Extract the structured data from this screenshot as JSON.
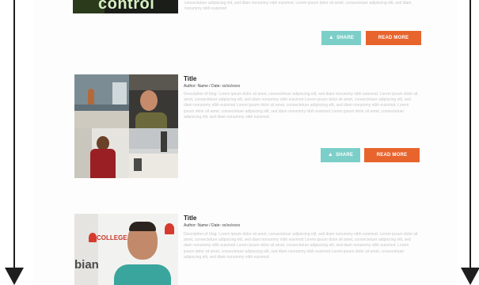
{
  "colors": {
    "share": "#7ccfc8",
    "read_more": "#e8642d",
    "arrow": "#1e1e1e"
  },
  "posts": [
    {
      "thumbnail_text": "control",
      "title": "",
      "meta": "",
      "description": "consectetuer adipiscing elit, sed diam nonummy nibh euismod. Lorem ipsum dolor sit amet, consectetuer adipiscing elit, sed diam nonummy nibh euismod",
      "share_label": "SHARE",
      "read_more_label": "READ MORE"
    },
    {
      "title": "Title",
      "meta": "Author: Name / Date: xx/xx/xxxx",
      "description": "Description of blog: Lorem ipsum dolor sit amet, consectetuer adipiscing elit, sed diam nonummy nibh euismod. Lorem ipsum dolor sit amet, consectetuer adipiscing elit, sed diam nonummy nibh euismod Lorem ipsum dolor sit amet, consectetuer adipiscing elit, sed diam nonummy nibh euismod Lorem ipsum dolor sit amet, consectetuer adipiscing elit, sed diam nonummy nibh euismod. Lorem ipsum dolor sit amet, consectetuer adipiscing elit, sed diam nonummy nibh euismod Lorem ipsum dolor sit amet, consectetuer adipiscing elit, sed diam nonummy nibh euismod.",
      "share_label": "SHARE",
      "read_more_label": "READ MORE"
    },
    {
      "thumbnail_text": "COLLEGE TO",
      "thumbnail_text_2": "bian",
      "title": "Title",
      "meta": "Author: Name / Date: xx/xx/xxxx",
      "description": "Description of blog: Lorem ipsum dolor sit amet, consectetuer adipiscing elit, sed diam nonummy nibh euismod. Lorem ipsum dolor sit amet, consectetuer adipiscing elit, sed diam nonummy nibh euismod Lorem ipsum dolor sit amet, consectetuer adipiscing elit, sed diam nonummy nibh euismod Lorem ipsum dolor sit amet, consectetuer adipiscing elit, sed diam nonummy nibh euismod. Lorem ipsum dolor sit amet, consectetuer adipiscing elit, sed diam nonummy nibh euismod Lorem ipsum dolor sit amet, consectetuer adipiscing elit, sed diam nonummy nibh euismod."
    }
  ]
}
